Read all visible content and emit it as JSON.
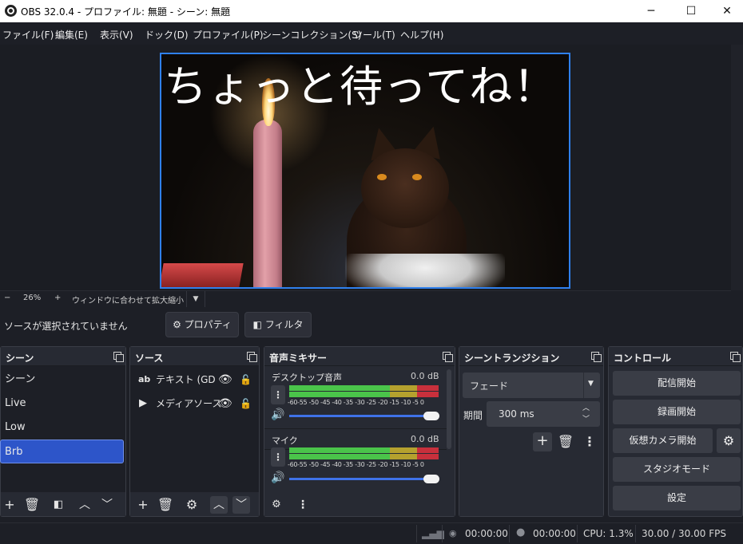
{
  "window": {
    "title": "OBS 32.0.4 - プロファイル: 無題 - シーン: 無題",
    "minimize": "─",
    "maximize": "☐",
    "close": "✕"
  },
  "menu": [
    "ファイル(F)",
    "編集(E)",
    "表示(V)",
    "ドック(D)",
    "プロファイル(P)",
    "シーンコレクション(S)",
    "ツール(T)",
    "ヘルプ(H)"
  ],
  "preview": {
    "overlay_text": "ちょっと待ってね！",
    "zoom_minus": "−",
    "zoom_level": "26%",
    "zoom_plus": "+",
    "fit_label": "ウィンドウに合わせて拡大縮小"
  },
  "source_bar": {
    "status": "ソースが選択されていません",
    "properties": "プロパティ",
    "filters": "フィルタ"
  },
  "scenes": {
    "title": "シーン",
    "items": [
      "シーン",
      "Live",
      "Low",
      "Brb"
    ],
    "selected": "Brb"
  },
  "sources": {
    "title": "ソース",
    "items": [
      {
        "icon": "text-icon",
        "label": "テキスト (GDI+"
      },
      {
        "icon": "media-source-icon",
        "label": "メディアソース"
      }
    ]
  },
  "mixer": {
    "title": "音声ミキサー",
    "channels": [
      {
        "name": "デスクトップ音声",
        "level": "0.0 dB",
        "volume": 1.0
      },
      {
        "name": "マイク",
        "level": "0.0 dB",
        "volume": 1.0
      }
    ],
    "ticks": "-60-55 -50 -45 -40 -35 -30 -25 -20 -15 -10 -5  0"
  },
  "transitions": {
    "title": "シーントランジション",
    "selected": "フェード",
    "duration_label": "期間",
    "duration_value": "300 ms"
  },
  "controls": {
    "title": "コントロール",
    "start_streaming": "配信開始",
    "start_recording": "録画開始",
    "virtual_camera": "仮想カメラ開始",
    "studio_mode": "スタジオモード",
    "settings": "設定"
  },
  "status": {
    "stream_time": "00:00:00",
    "record_time": "00:00:00",
    "cpu": "CPU: 1.3%",
    "fps": "30.00 / 30.00 FPS"
  },
  "colors": {
    "accent": "#2f80ed",
    "selection": "#2d55c9",
    "meter_green": "#4ac44a",
    "meter_yellow": "#b5a12e",
    "meter_red": "#c8303c"
  }
}
